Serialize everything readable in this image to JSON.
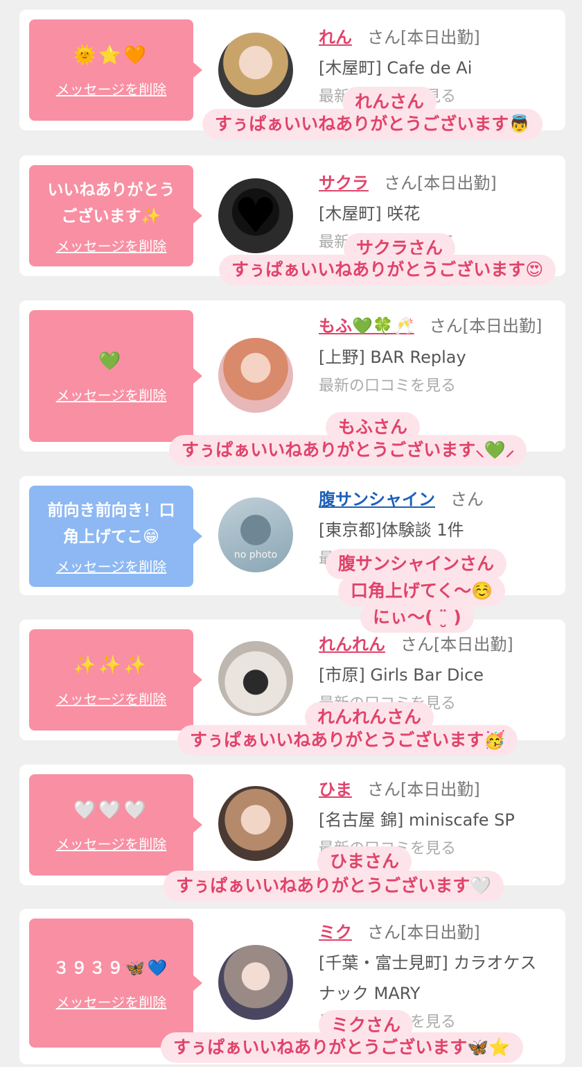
{
  "delete_label": "メッセージを削除",
  "san": "さん",
  "latest_text": "最新の口コミを見る",
  "no_photo": "no photo",
  "colors": {
    "pink_bubble": "#f98fa3",
    "blue_bubble": "#8db8f3",
    "name_pink": "#e0436a",
    "name_blue": "#1d5fb8",
    "caption_bg": "#fde4ea"
  },
  "cards": [
    {
      "message": "🌞⭐🧡",
      "name": "れん",
      "status": "[本日出勤]",
      "shop": "[木屋町] Cafe de Ai",
      "caption_name": "れんさん",
      "caption_text": "すぅぱぁいいねありがとうございます👼"
    },
    {
      "message": "いいねありがとう\nございます✨",
      "name": "サクラ",
      "status": "[本日出勤]",
      "shop": "[木屋町] 咲花",
      "caption_name": "サクラさん",
      "caption_text": "すぅぱぁいいねありがとうございます😍"
    },
    {
      "message": "💚",
      "name": "もふ💚🍀🥂",
      "status": "[本日出勤]",
      "shop": "[上野] BAR Replay",
      "caption_name": "もふさん",
      "caption_text": "すぅぱぁいいねありがとうございます⸜💚⸝‍"
    },
    {
      "message": "前向き前向き！口\n角上げてこ😁",
      "name": "腹サンシャイン",
      "status": "",
      "shop": "[東京都]体験談 1件",
      "caption_name": "腹サンシャインさん",
      "caption_line2": "口角上げてく〜☺️",
      "caption_line3": "にぃ〜( ¨̮ )"
    },
    {
      "message": "✨✨✨",
      "name": "れんれん",
      "status": "[本日出勤]",
      "shop": "[市原] Girls Bar Dice",
      "caption_name": "れんれんさん",
      "caption_text": "すぅぱぁいいねありがとうございます🥳"
    },
    {
      "message": "🤍🤍🤍",
      "name": "ひま",
      "status": "[本日出勤]",
      "shop": "[名古屋 錦] miniscafe SP",
      "caption_name": "ひまさん",
      "caption_text": "すぅぱぁいいねありがとうございます🤍"
    },
    {
      "message": "３９３９🦋💙",
      "name": "ミク",
      "status": "[本日出勤]",
      "shop": "[千葉・富士見町] カラオケスナック MARY",
      "caption_name": "ミクさん",
      "caption_text": "すぅぱぁいいねありがとうございます🦋⭐"
    }
  ]
}
